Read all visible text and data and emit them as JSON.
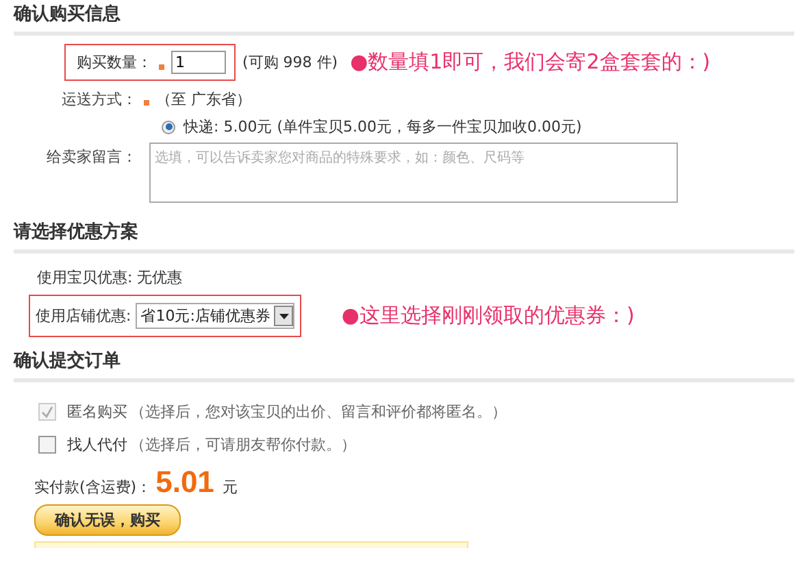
{
  "purchase_info": {
    "heading": "确认购买信息",
    "quantity": {
      "label": "购买数量：",
      "value": "1",
      "available": "(可购  998 件)"
    },
    "quantity_note": "●数量填1即可，我们会寄2盒套套的：)",
    "shipping": {
      "label": "运送方式：",
      "destination": "（至  广东省）",
      "options": [
        {
          "label": "快递: 5.00元 (单件宝贝5.00元，每多一件宝贝加收0.00元)",
          "selected": true
        }
      ]
    },
    "message": {
      "label": "给卖家留言：",
      "placeholder": "选填，可以告诉卖家您对商品的特殊要求，如：颜色、尺码等"
    }
  },
  "discount": {
    "heading": "请选择优惠方案",
    "item_discount": "使用宝贝优惠: 无优惠",
    "shop_discount": {
      "label": "使用店铺优惠:",
      "value": "省10元:店铺优惠券"
    },
    "note": "●这里选择刚刚领取的优惠券：)"
  },
  "confirm": {
    "heading": "确认提交订单",
    "options": [
      {
        "label": "匿名购买",
        "hint": "（选择后，您对该宝贝的出价、留言和评价都将匿名。）",
        "checked": true,
        "disabled": true
      },
      {
        "label": "找人代付",
        "hint": "（选择后，可请朋友帮你付款。）",
        "checked": false,
        "disabled": false
      }
    ],
    "total": {
      "label": "实付款(含运费)：",
      "amount": "5.01",
      "unit": "元"
    },
    "submit": "确认无误，购买"
  }
}
